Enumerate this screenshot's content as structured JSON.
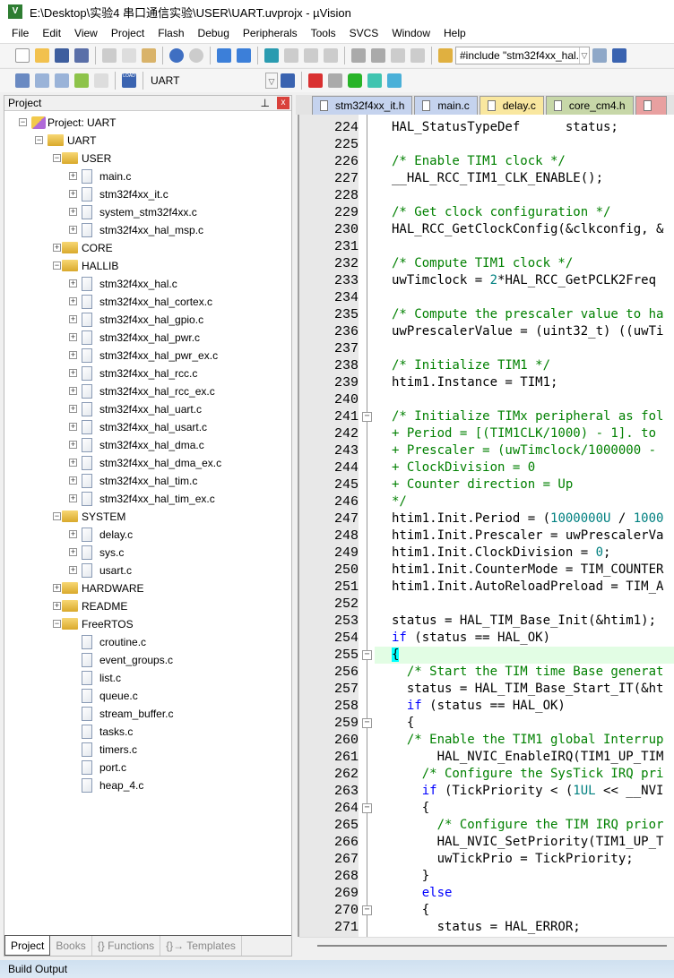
{
  "window": {
    "title": "E:\\Desktop\\实验4 串口通信实验\\USER\\UART.uvprojx - µVision",
    "logo": "V"
  },
  "menu": [
    "File",
    "Edit",
    "View",
    "Project",
    "Flash",
    "Debug",
    "Peripherals",
    "Tools",
    "SVCS",
    "Window",
    "Help"
  ],
  "toolbar": {
    "find_combo": "#include \"stm32f4xx_hal.",
    "target_combo": "UART",
    "load_label": "LOAD"
  },
  "project_panel": {
    "title": "Project",
    "close": "x",
    "pin": "⊥",
    "tree": [
      {
        "label": "Project: UART",
        "level": 0,
        "type": "project",
        "exp": "-"
      },
      {
        "label": "UART",
        "level": 1,
        "type": "folder",
        "exp": "-"
      },
      {
        "label": "USER",
        "level": 2,
        "type": "folder",
        "exp": "-"
      },
      {
        "label": "main.c",
        "level": 3,
        "type": "file",
        "exp": "+"
      },
      {
        "label": "stm32f4xx_it.c",
        "level": 3,
        "type": "file",
        "exp": "+"
      },
      {
        "label": "system_stm32f4xx.c",
        "level": 3,
        "type": "file",
        "exp": "+"
      },
      {
        "label": "stm32f4xx_hal_msp.c",
        "level": 3,
        "type": "file",
        "exp": "+"
      },
      {
        "label": "CORE",
        "level": 2,
        "type": "folder",
        "exp": "+"
      },
      {
        "label": "HALLIB",
        "level": 2,
        "type": "folder",
        "exp": "-"
      },
      {
        "label": "stm32f4xx_hal.c",
        "level": 3,
        "type": "file",
        "exp": "+"
      },
      {
        "label": "stm32f4xx_hal_cortex.c",
        "level": 3,
        "type": "file",
        "exp": "+"
      },
      {
        "label": "stm32f4xx_hal_gpio.c",
        "level": 3,
        "type": "file",
        "exp": "+"
      },
      {
        "label": "stm32f4xx_hal_pwr.c",
        "level": 3,
        "type": "file",
        "exp": "+"
      },
      {
        "label": "stm32f4xx_hal_pwr_ex.c",
        "level": 3,
        "type": "file",
        "exp": "+"
      },
      {
        "label": "stm32f4xx_hal_rcc.c",
        "level": 3,
        "type": "file",
        "exp": "+"
      },
      {
        "label": "stm32f4xx_hal_rcc_ex.c",
        "level": 3,
        "type": "file",
        "exp": "+"
      },
      {
        "label": "stm32f4xx_hal_uart.c",
        "level": 3,
        "type": "file",
        "exp": "+"
      },
      {
        "label": "stm32f4xx_hal_usart.c",
        "level": 3,
        "type": "file",
        "exp": "+"
      },
      {
        "label": "stm32f4xx_hal_dma.c",
        "level": 3,
        "type": "file",
        "exp": "+"
      },
      {
        "label": "stm32f4xx_hal_dma_ex.c",
        "level": 3,
        "type": "file",
        "exp": "+"
      },
      {
        "label": "stm32f4xx_hal_tim.c",
        "level": 3,
        "type": "file",
        "exp": "+"
      },
      {
        "label": "stm32f4xx_hal_tim_ex.c",
        "level": 3,
        "type": "file",
        "exp": "+"
      },
      {
        "label": "SYSTEM",
        "level": 2,
        "type": "folder",
        "exp": "-"
      },
      {
        "label": "delay.c",
        "level": 3,
        "type": "file",
        "exp": "+"
      },
      {
        "label": "sys.c",
        "level": 3,
        "type": "file",
        "exp": "+"
      },
      {
        "label": "usart.c",
        "level": 3,
        "type": "file",
        "exp": "+"
      },
      {
        "label": "HARDWARE",
        "level": 2,
        "type": "folder",
        "exp": "+"
      },
      {
        "label": "README",
        "level": 2,
        "type": "folder",
        "exp": "+"
      },
      {
        "label": "FreeRTOS",
        "level": 2,
        "type": "folder",
        "exp": "-"
      },
      {
        "label": "croutine.c",
        "level": 3,
        "type": "file",
        "exp": ""
      },
      {
        "label": "event_groups.c",
        "level": 3,
        "type": "file",
        "exp": ""
      },
      {
        "label": "list.c",
        "level": 3,
        "type": "file",
        "exp": ""
      },
      {
        "label": "queue.c",
        "level": 3,
        "type": "file",
        "exp": ""
      },
      {
        "label": "stream_buffer.c",
        "level": 3,
        "type": "file",
        "exp": ""
      },
      {
        "label": "tasks.c",
        "level": 3,
        "type": "file",
        "exp": ""
      },
      {
        "label": "timers.c",
        "level": 3,
        "type": "file",
        "exp": ""
      },
      {
        "label": "port.c",
        "level": 3,
        "type": "file",
        "exp": ""
      },
      {
        "label": "heap_4.c",
        "level": 3,
        "type": "file",
        "exp": ""
      }
    ],
    "bottom_tabs": [
      {
        "label": "Project",
        "active": true
      },
      {
        "label": "Books"
      },
      {
        "label": "{} Functions"
      },
      {
        "label": "{}→ Templates"
      }
    ]
  },
  "editor_tabs": [
    {
      "label": "stm32f4xx_it.h",
      "color": "#c5d3ee"
    },
    {
      "label": "main.c",
      "color": "#c5d3ee"
    },
    {
      "label": "delay.c",
      "color": "#f9e79f"
    },
    {
      "label": "core_cm4.h",
      "color": "#c7d7a8"
    },
    {
      "label": "",
      "color": "#e8a0a0"
    }
  ],
  "code": [
    {
      "n": "224",
      "s": [
        [
          "",
          "HAL_StatusTypeDef      status;"
        ]
      ]
    },
    {
      "n": "225",
      "s": []
    },
    {
      "n": "226",
      "s": [
        [
          "c",
          "/* Enable TIM1 clock */"
        ]
      ]
    },
    {
      "n": "227",
      "s": [
        [
          "",
          "__HAL_RCC_TIM1_CLK_ENABLE();"
        ]
      ]
    },
    {
      "n": "228",
      "s": []
    },
    {
      "n": "229",
      "s": [
        [
          "c",
          "/* Get clock configuration */"
        ]
      ]
    },
    {
      "n": "230",
      "s": [
        [
          "",
          "HAL_RCC_GetClockConfig(&clkconfig, &"
        ]
      ]
    },
    {
      "n": "231",
      "s": []
    },
    {
      "n": "232",
      "s": [
        [
          "c",
          "/* Compute TIM1 clock */"
        ]
      ]
    },
    {
      "n": "233",
      "s": [
        [
          "",
          "uwTimclock = "
        ],
        [
          "n",
          "2"
        ],
        [
          "",
          "*HAL_RCC_GetPCLK2Freq"
        ]
      ]
    },
    {
      "n": "234",
      "s": []
    },
    {
      "n": "235",
      "s": [
        [
          "c",
          "/* Compute the prescaler value to ha"
        ]
      ]
    },
    {
      "n": "236",
      "s": [
        [
          "",
          "uwPrescalerValue = (uint32_t) ((uwTi"
        ]
      ]
    },
    {
      "n": "237",
      "s": []
    },
    {
      "n": "238",
      "s": [
        [
          "c",
          "/* Initialize TIM1 */"
        ]
      ]
    },
    {
      "n": "239",
      "s": [
        [
          "",
          "htim1.Instance = TIM1;"
        ]
      ]
    },
    {
      "n": "240",
      "s": []
    },
    {
      "n": "241",
      "f": "-",
      "s": [
        [
          "c",
          "/* Initialize TIMx peripheral as fol"
        ]
      ]
    },
    {
      "n": "242",
      "s": [
        [
          "c",
          "+ Period = [(TIM1CLK/1000) - 1]. to"
        ]
      ]
    },
    {
      "n": "243",
      "s": [
        [
          "c",
          "+ Prescaler = (uwTimclock/1000000 - "
        ]
      ]
    },
    {
      "n": "244",
      "s": [
        [
          "c",
          "+ ClockDivision = 0"
        ]
      ]
    },
    {
      "n": "245",
      "s": [
        [
          "c",
          "+ Counter direction = Up"
        ]
      ]
    },
    {
      "n": "246",
      "s": [
        [
          "c",
          "*/"
        ]
      ]
    },
    {
      "n": "247",
      "s": [
        [
          "",
          "htim1.Init.Period = ("
        ],
        [
          "n",
          "1000000U"
        ],
        [
          "",
          " / "
        ],
        [
          "n",
          "1000"
        ]
      ]
    },
    {
      "n": "248",
      "s": [
        [
          "",
          "htim1.Init.Prescaler = uwPrescalerVa"
        ]
      ]
    },
    {
      "n": "249",
      "s": [
        [
          "",
          "htim1.Init.ClockDivision = "
        ],
        [
          "n",
          "0"
        ],
        [
          "",
          ";"
        ]
      ]
    },
    {
      "n": "250",
      "s": [
        [
          "",
          "htim1.Init.CounterMode = TIM_COUNTER"
        ]
      ]
    },
    {
      "n": "251",
      "s": [
        [
          "",
          "htim1.Init.AutoReloadPreload = TIM_A"
        ]
      ]
    },
    {
      "n": "252",
      "s": []
    },
    {
      "n": "253",
      "s": [
        [
          "",
          "status = HAL_TIM_Base_Init(&htim1);"
        ]
      ]
    },
    {
      "n": "254",
      "s": [
        [
          "k",
          "if"
        ],
        [
          "",
          " (status == HAL_OK)"
        ]
      ]
    },
    {
      "n": "255",
      "f": "-",
      "hl": true,
      "s": [
        [
          "b",
          "{"
        ]
      ]
    },
    {
      "n": "256",
      "s": [
        [
          "",
          "  "
        ],
        [
          "c",
          "/* Start the TIM time Base generat"
        ]
      ]
    },
    {
      "n": "257",
      "s": [
        [
          "",
          "  status = HAL_TIM_Base_Start_IT(&ht"
        ]
      ]
    },
    {
      "n": "258",
      "s": [
        [
          "",
          "  "
        ],
        [
          "k",
          "if"
        ],
        [
          "",
          " (status == HAL_OK)"
        ]
      ]
    },
    {
      "n": "259",
      "f": "-",
      "s": [
        [
          "",
          "  {"
        ]
      ]
    },
    {
      "n": "260",
      "s": [
        [
          "",
          "  "
        ],
        [
          "c",
          "/* Enable the TIM1 global Interrup"
        ]
      ]
    },
    {
      "n": "261",
      "s": [
        [
          "",
          "      HAL_NVIC_EnableIRQ(TIM1_UP_TIM"
        ]
      ]
    },
    {
      "n": "262",
      "s": [
        [
          "",
          "    "
        ],
        [
          "c",
          "/* Configure the SysTick IRQ pri"
        ]
      ]
    },
    {
      "n": "263",
      "s": [
        [
          "",
          "    "
        ],
        [
          "k",
          "if"
        ],
        [
          "",
          " (TickPriority < ("
        ],
        [
          "n",
          "1UL"
        ],
        [
          "",
          " << __NVI"
        ]
      ]
    },
    {
      "n": "264",
      "f": "-",
      "s": [
        [
          "",
          "    {"
        ]
      ]
    },
    {
      "n": "265",
      "s": [
        [
          "",
          "      "
        ],
        [
          "c",
          "/* Configure the TIM IRQ prior"
        ]
      ]
    },
    {
      "n": "266",
      "s": [
        [
          "",
          "      HAL_NVIC_SetPriority(TIM1_UP_T"
        ]
      ]
    },
    {
      "n": "267",
      "s": [
        [
          "",
          "      uwTickPrio = TickPriority;"
        ]
      ]
    },
    {
      "n": "268",
      "f": "end",
      "s": [
        [
          "",
          "    }"
        ]
      ]
    },
    {
      "n": "269",
      "s": [
        [
          "",
          "    "
        ],
        [
          "k",
          "else"
        ]
      ]
    },
    {
      "n": "270",
      "f": "-",
      "s": [
        [
          "",
          "    {"
        ]
      ]
    },
    {
      "n": "271",
      "s": [
        [
          "",
          "      status = HAL_ERROR;"
        ]
      ]
    }
  ],
  "build_output": {
    "title": "Build Output"
  }
}
